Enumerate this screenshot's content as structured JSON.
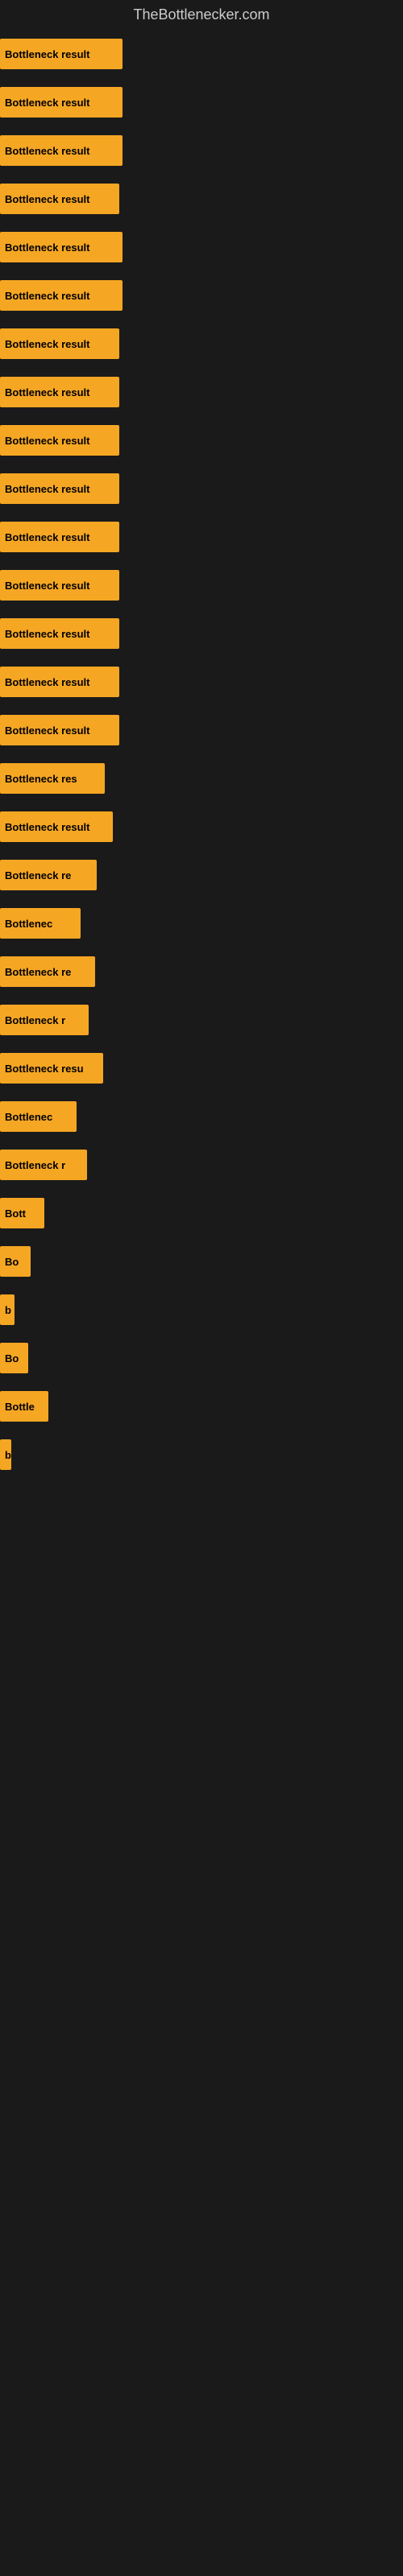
{
  "site": {
    "title": "TheBottlenecker.com"
  },
  "bars": [
    {
      "label": "Bottleneck result",
      "width": 152
    },
    {
      "label": "Bottleneck result",
      "width": 152
    },
    {
      "label": "Bottleneck result",
      "width": 152
    },
    {
      "label": "Bottleneck result",
      "width": 148
    },
    {
      "label": "Bottleneck result",
      "width": 152
    },
    {
      "label": "Bottleneck result",
      "width": 152
    },
    {
      "label": "Bottleneck result",
      "width": 148
    },
    {
      "label": "Bottleneck result",
      "width": 148
    },
    {
      "label": "Bottleneck result",
      "width": 148
    },
    {
      "label": "Bottleneck result",
      "width": 148
    },
    {
      "label": "Bottleneck result",
      "width": 148
    },
    {
      "label": "Bottleneck result",
      "width": 148
    },
    {
      "label": "Bottleneck result",
      "width": 148
    },
    {
      "label": "Bottleneck result",
      "width": 148
    },
    {
      "label": "Bottleneck result",
      "width": 148
    },
    {
      "label": "Bottleneck res",
      "width": 130
    },
    {
      "label": "Bottleneck result",
      "width": 140
    },
    {
      "label": "Bottleneck re",
      "width": 120
    },
    {
      "label": "Bottlenec",
      "width": 100
    },
    {
      "label": "Bottleneck re",
      "width": 118
    },
    {
      "label": "Bottleneck r",
      "width": 110
    },
    {
      "label": "Bottleneck resu",
      "width": 128
    },
    {
      "label": "Bottlenec",
      "width": 95
    },
    {
      "label": "Bottleneck r",
      "width": 108
    },
    {
      "label": "Bott",
      "width": 55
    },
    {
      "label": "Bo",
      "width": 38
    },
    {
      "label": "b",
      "width": 18
    },
    {
      "label": "Bo",
      "width": 35
    },
    {
      "label": "Bottle",
      "width": 60
    },
    {
      "label": "b",
      "width": 14
    },
    {
      "label": "",
      "width": 0
    },
    {
      "label": "",
      "width": 0
    },
    {
      "label": "",
      "width": 0
    },
    {
      "label": "",
      "width": 0
    },
    {
      "label": "",
      "width": 0
    },
    {
      "label": "",
      "width": 0
    },
    {
      "label": "",
      "width": 0
    },
    {
      "label": "",
      "width": 0
    },
    {
      "label": "",
      "width": 0
    },
    {
      "label": "",
      "width": 0
    }
  ],
  "colors": {
    "bar_fill": "#f5a623",
    "background": "#1a1a1a",
    "title_color": "#cccccc",
    "bar_text": "#000000"
  }
}
